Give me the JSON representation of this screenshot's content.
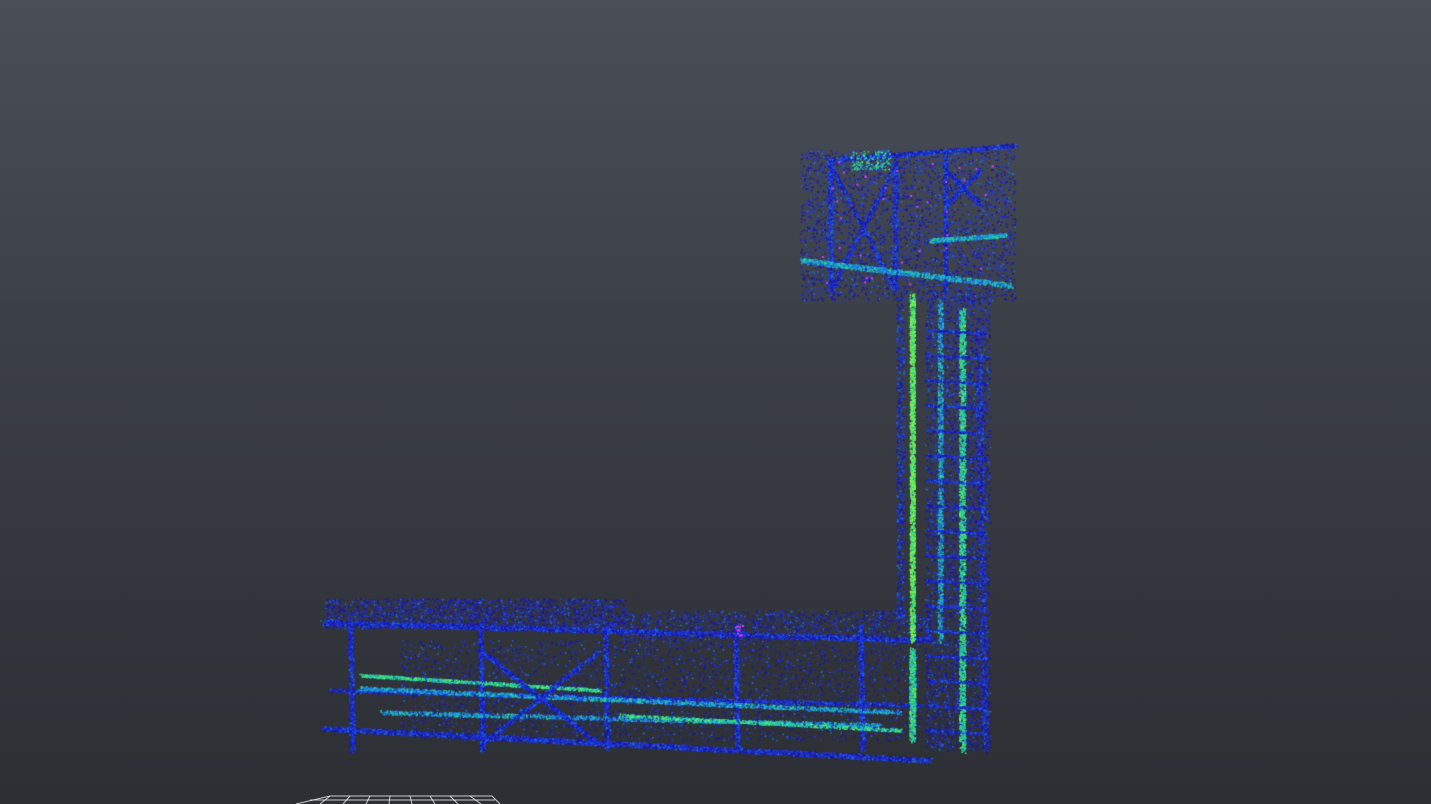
{
  "viewer": {
    "background_colors": {
      "top": "#4a4f57",
      "bottom": "#2c2f34"
    },
    "colormap": [
      "#1a16a8",
      "#1f38e0",
      "#1e6fe6",
      "#1fb7c9",
      "#2fe07a",
      "#7cf25a"
    ],
    "highlight_color": "#d63cff",
    "grid_color": "#ffffff"
  },
  "scene": {
    "object": "point-cloud-structure",
    "elements": [
      "platform-frame",
      "vertical-tower",
      "tower-top-deck",
      "ground-grid"
    ]
  }
}
